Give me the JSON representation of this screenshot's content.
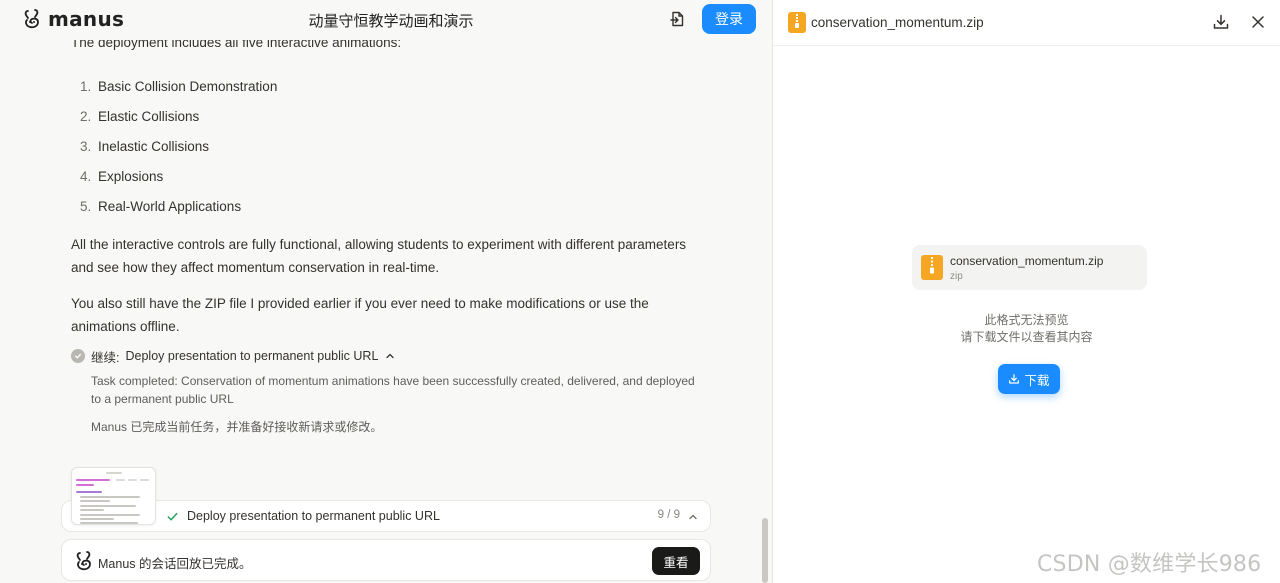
{
  "header": {
    "brand": "manus",
    "title": "动量守恒教学动画和演示",
    "login_label": "登录"
  },
  "content": {
    "intro_text": "The deployment includes all five interactive animations:",
    "animations": [
      {
        "num": "1.",
        "label": "Basic Collision Demonstration"
      },
      {
        "num": "2.",
        "label": "Elastic Collisions"
      },
      {
        "num": "3.",
        "label": "Inelastic Collisions"
      },
      {
        "num": "4.",
        "label": "Explosions"
      },
      {
        "num": "5.",
        "label": "Real-World Applications"
      }
    ],
    "para_controls": "All the interactive controls are fully functional, allowing students to experiment with different parameters and see how they affect momentum conservation in real-time.",
    "para_zip": "You also still have the ZIP file I provided earlier if you ever need to make modifications or use the animations offline."
  },
  "step": {
    "prefix": "继续:",
    "title": "Deploy presentation to permanent public URL",
    "detail": "Task completed: Conservation of momentum animations have been successfully created, delivered, and deployed to a permanent public URL",
    "status": "Manus 已完成当前任务，并准备好接收新请求或修改。"
  },
  "progress": {
    "label": "Deploy presentation to permanent public URL",
    "count": "9 / 9"
  },
  "replay": {
    "text": "Manus 的会话回放已完成。",
    "button": "重看"
  },
  "file_panel": {
    "filename": "conservation_momentum.zip",
    "card_name": "conservation_momentum.zip",
    "card_ext": "zip",
    "no_preview_line1": "此格式无法预览",
    "no_preview_line2": "请下载文件以查看其内容",
    "download_label": "下载"
  },
  "watermark": "CSDN @数维学长986",
  "colors": {
    "accent": "#1a8cff",
    "zip_icon": "#f5a623",
    "background": "#f8f8f7"
  },
  "icons": [
    "manus-logo-icon",
    "share-icon",
    "check-circle-icon",
    "chevron-up-icon",
    "check-icon",
    "zip-file-icon",
    "download-icon",
    "close-icon"
  ]
}
